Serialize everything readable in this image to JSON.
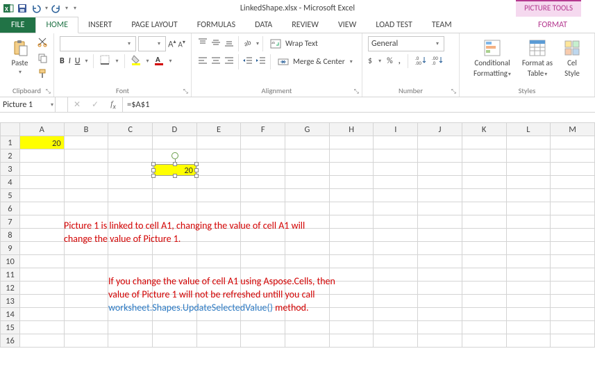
{
  "title": "LinkedShape.xlsx - Microsoft Excel",
  "contextual_tab": "PICTURE TOOLS",
  "tabs": {
    "file": "FILE",
    "home": "HOME",
    "insert": "INSERT",
    "page_layout": "PAGE LAYOUT",
    "formulas": "FORMULAS",
    "data": "DATA",
    "review": "REVIEW",
    "view": "VIEW",
    "load_test": "LOAD TEST",
    "team": "TEAM",
    "format": "FORMAT"
  },
  "ribbon": {
    "clipboard": {
      "paste": "Paste",
      "label": "Clipboard"
    },
    "font": {
      "label": "Font",
      "a_inc": "A",
      "a_dec": "A"
    },
    "alignment": {
      "label": "Alignment",
      "wrap": "Wrap Text",
      "merge": "Merge & Center"
    },
    "number": {
      "label": "Number",
      "format": "General",
      "currency": "$",
      "percent": "%",
      "comma": ","
    },
    "styles": {
      "label": "Styles",
      "cond": "Conditional",
      "cond2": "Formatting",
      "fmt_table": "Format as",
      "fmt_table2": "Table",
      "cell": "Cel",
      "cell2": "Style"
    }
  },
  "name_box": "Picture 1",
  "formula": "=$A$1",
  "cells": {
    "A1": "20"
  },
  "linked_picture_value": "20",
  "annotation1_l1": "Picture 1 is linked to cell A1, changing the value of cell A1 will",
  "annotation1_l2": "change the value of Picture 1.",
  "annotation2_l1": "If you change the value of cell A1 using Aspose.Cells, then",
  "annotation2_l2": "value of Picture 1 will not be refreshed untill you call",
  "annotation2_code": "worksheet.Shapes.UpdateSelectedValue()",
  "annotation2_tail": " method."
}
